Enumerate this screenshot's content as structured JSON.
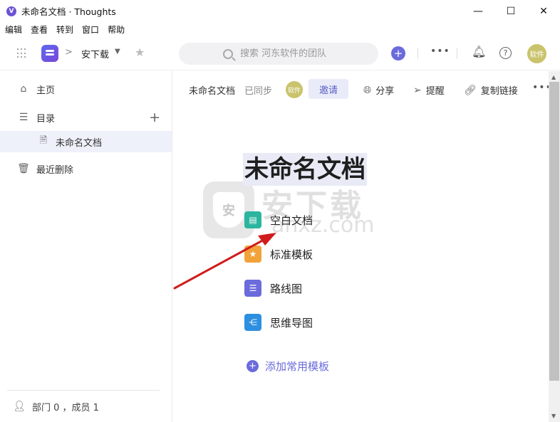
{
  "window": {
    "title": "未命名文档 · Thoughts",
    "controls": {
      "minimize": "—",
      "maximize": "☐",
      "close": "✕"
    }
  },
  "menubar": {
    "items": [
      "编辑",
      "查看",
      "转到",
      "窗口",
      "帮助"
    ]
  },
  "toolbar": {
    "breadcrumb_sep": ">",
    "workspace": "安下载",
    "search_placeholder": "搜索 河东软件的团队",
    "user_avatar": "软件"
  },
  "sidebar": {
    "home": "主页",
    "catalog": "目录",
    "doc_item": "未命名文档",
    "recently_deleted": "最近删除",
    "footer": "部门 0 ，成员 1"
  },
  "doc_header": {
    "name": "未命名文档",
    "status": "已同步",
    "avatar": "软件",
    "invite": "邀请",
    "share": "分享",
    "remind": "提醒",
    "copy_link": "复制链接"
  },
  "document": {
    "title": "未命名文档",
    "templates": [
      {
        "label": "空白文档",
        "icon": "blank-doc-icon",
        "color": "#2bb59e"
      },
      {
        "label": "标准模板",
        "icon": "star-template-icon",
        "color": "#f2a23a"
      },
      {
        "label": "路线图",
        "icon": "roadmap-icon",
        "color": "#6b6bdc"
      },
      {
        "label": "思维导图",
        "icon": "mindmap-icon",
        "color": "#2d8fe0"
      }
    ],
    "add_template": "添加常用模板"
  },
  "watermark": {
    "cn": "安下载",
    "en": "anxz.com",
    "shield_char": "安"
  },
  "colors": {
    "accent": "#6b6bdc",
    "selected_bg": "#eef0fa",
    "arrow": "#d01c1c"
  }
}
